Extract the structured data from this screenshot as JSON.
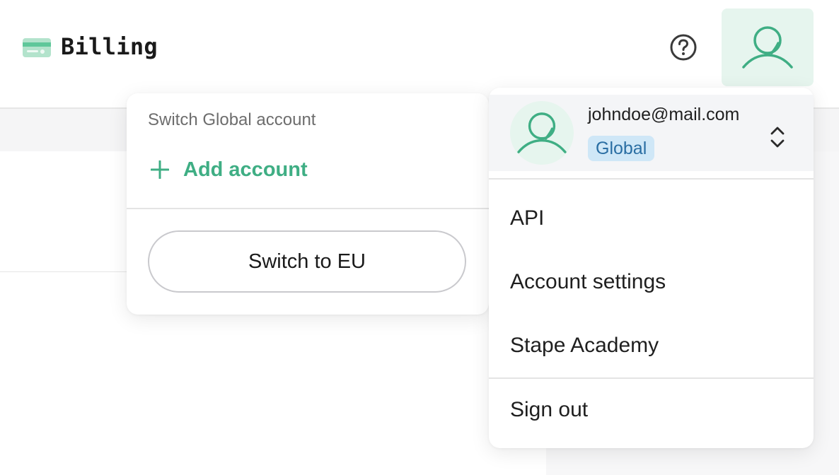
{
  "header": {
    "title": "Billing",
    "title_icon": "credit-card-icon",
    "help_icon": "help-circle-icon",
    "avatar_icon": "user-icon"
  },
  "switch_popover": {
    "heading": "Switch Global account",
    "add_account_icon": "plus-icon",
    "add_account_label": "Add account",
    "switch_button_label": "Switch to EU"
  },
  "user_menu": {
    "email": "johndoe@mail.com",
    "region_badge": "Global",
    "avatar_icon": "user-icon",
    "toggle_icon": "chevron-up-down-icon",
    "items": [
      {
        "label": "API"
      },
      {
        "label": "Account settings"
      },
      {
        "label": "Stape Academy"
      }
    ],
    "sign_out_label": "Sign out"
  },
  "colors": {
    "accent_green": "#3fae84",
    "avatar_bg": "#e6f5ee",
    "badge_bg": "#cfe7f7",
    "badge_text": "#2a6ea3"
  }
}
